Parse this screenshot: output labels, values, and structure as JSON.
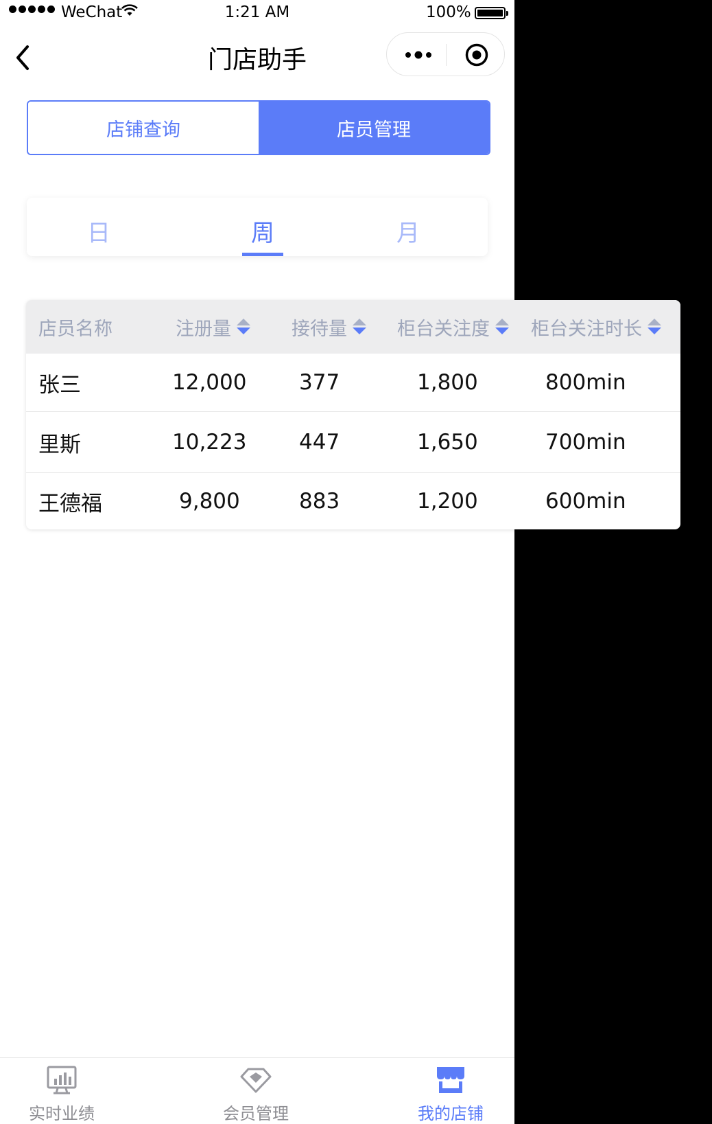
{
  "status_bar": {
    "carrier": "WeChat",
    "time": "1:21 AM",
    "battery": "100%"
  },
  "nav": {
    "title": "门店助手"
  },
  "segmented": {
    "items": [
      {
        "label": "店铺查询",
        "active": false
      },
      {
        "label": "店员管理",
        "active": true
      }
    ]
  },
  "period_tabs": {
    "items": [
      {
        "label": "日",
        "active": false
      },
      {
        "label": "周",
        "active": true
      },
      {
        "label": "月",
        "active": false
      }
    ]
  },
  "table": {
    "headers": [
      "店员名称",
      "注册量",
      "接待量",
      "柜台关注度",
      "柜台关注时长"
    ],
    "rows": [
      [
        "张三",
        "12,000",
        "377",
        "1,800",
        "800min"
      ],
      [
        "里斯",
        "10,223",
        "447",
        "1,650",
        "700min"
      ],
      [
        "王德福",
        "9,800",
        "883",
        "1,200",
        "600min"
      ]
    ]
  },
  "tab_bar": {
    "items": [
      {
        "label": "实时业绩",
        "icon": "chart-monitor-icon",
        "active": false
      },
      {
        "label": "会员管理",
        "icon": "diamond-icon",
        "active": false
      },
      {
        "label": "我的店铺",
        "icon": "store-icon",
        "active": true
      }
    ]
  },
  "colors": {
    "accent": "#5b7cf8",
    "accent_light": "#a8b9f9",
    "header_bg": "#ededee",
    "header_text": "#9ea6bb",
    "tab_inactive": "#8e8e93"
  }
}
